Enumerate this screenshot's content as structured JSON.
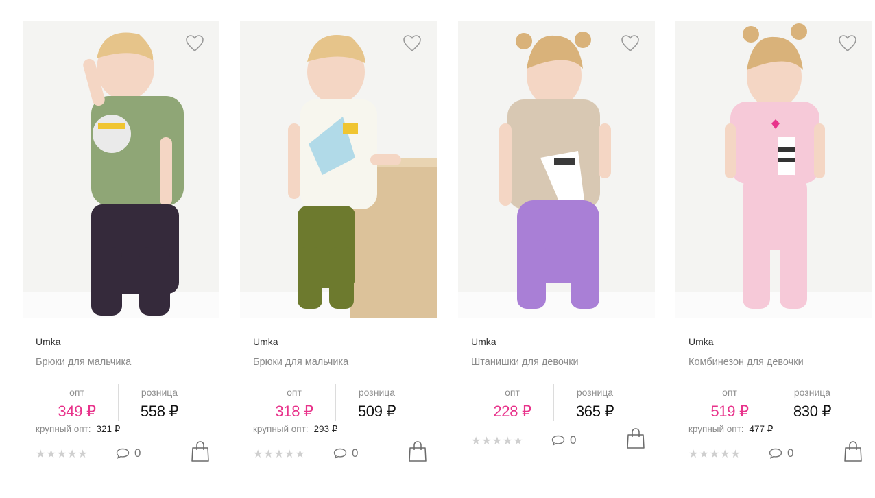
{
  "products": [
    {
      "brand": "Umka",
      "title": "Брюки для мальчика",
      "opt_label": "опт",
      "opt_price": "349 ₽",
      "retail_label": "розница",
      "retail_price": "558 ₽",
      "bulk_label": "крупный опт:",
      "bulk_price": "321 ₽",
      "comments": "0",
      "colors": {
        "top": "#8fa676",
        "pants": "#352a3b"
      }
    },
    {
      "brand": "Umka",
      "title": "Брюки для мальчика",
      "opt_label": "опт",
      "opt_price": "318 ₽",
      "retail_label": "розница",
      "retail_price": "509 ₽",
      "bulk_label": "крупный опт:",
      "bulk_price": "293 ₽",
      "comments": "0",
      "colors": {
        "top": "#f7f6ee",
        "pants": "#6d7a2e"
      }
    },
    {
      "brand": "Umka",
      "title": "Штанишки для девочки",
      "opt_label": "опт",
      "opt_price": "228 ₽",
      "retail_label": "розница",
      "retail_price": "365 ₽",
      "comments": "0",
      "colors": {
        "top": "#d8c8b3",
        "pants": "#a97fd6"
      }
    },
    {
      "brand": "Umka",
      "title": "Комбинезон для девочки",
      "opt_label": "опт",
      "opt_price": "519 ₽",
      "retail_label": "розница",
      "retail_price": "830 ₽",
      "bulk_label": "крупный опт:",
      "bulk_price": "477 ₽",
      "comments": "0",
      "colors": {
        "top": "#f6c9d8",
        "pants": "#f6c9d8"
      }
    }
  ],
  "rating_stars": "★★★★★",
  "icons": {
    "favorite": "heart-outline-icon",
    "comments": "speech-bubble-icon",
    "cart": "shopping-bag-icon"
  },
  "accent_color": "#e8338b"
}
